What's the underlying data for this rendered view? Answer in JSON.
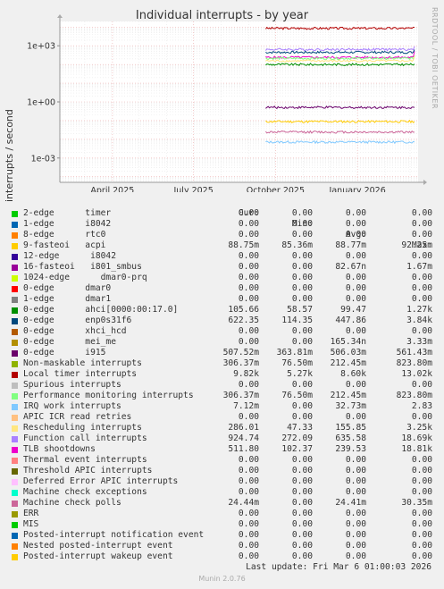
{
  "chart_data": {
    "type": "line",
    "title": "Individual interrupts - by year",
    "ylabel": "interrupts / second",
    "yscale": "log",
    "ylim": [
      5e-05,
      20000
    ],
    "ytick_labels": [
      "1e+03",
      "1e+00",
      "1e-03"
    ],
    "ytick_values": [
      1000,
      1,
      0.001
    ],
    "xlim": [
      "2025-02-01",
      "2026-03-10"
    ],
    "xtick_labels": [
      "April 2025",
      "July 2025",
      "October 2025",
      "January 2026"
    ],
    "xtick_dates": [
      "2025-04-01",
      "2025-07-01",
      "2025-10-01",
      "2026-01-01"
    ],
    "grid": true,
    "data_start": "2025-09-20",
    "series": [
      {
        "name": "Local timer interrupts",
        "values": [
          9820,
          8600,
          13020,
          5270
        ]
      },
      {
        "name": "Function call interrupts",
        "values": [
          924.74,
          635.58,
          18690,
          272.09
        ]
      },
      {
        "name": "TLB shootdowns",
        "values": [
          511.8,
          239.53,
          18810,
          102.37
        ]
      },
      {
        "name": "Performance monitoring interrupts",
        "values": [
          306.37,
          212.45,
          823.8,
          76.5
        ]
      },
      {
        "name": "enp0s31f6",
        "values": [
          622.35,
          447.86,
          3840,
          114.35
        ]
      },
      {
        "name": "Rescheduling interrupts",
        "values": [
          286.01,
          155.85,
          3250,
          47.33
        ]
      },
      {
        "name": "ahci[0000:00:17.0]",
        "values": [
          105.66,
          99.47,
          1270,
          58.57
        ]
      },
      {
        "name": "i915",
        "values": [
          0.50752,
          0.50603,
          0.56143,
          0.36381
        ]
      },
      {
        "name": "acpi",
        "values": [
          0.08875,
          0.08877,
          0.09225,
          0.08536
        ]
      },
      {
        "name": "Machine check polls",
        "values": [
          0.02444,
          0.02441,
          0.03035,
          0
        ]
      },
      {
        "name": "IRQ work interrupts",
        "values": [
          0.00712,
          0.0,
          2.83,
          0
        ]
      }
    ]
  },
  "legend": {
    "headers": {
      "cur": "Cur:",
      "min": "Min:",
      "avg": "Avg:",
      "max": "Max:"
    },
    "rows": [
      {
        "label": "2-edge      timer",
        "color": "#00cc00",
        "cur": "0.00",
        "min": "0.00",
        "avg": "0.00",
        "max": "0.00"
      },
      {
        "label": "1-edge      i8042",
        "color": "#0066b3",
        "cur": "0.00",
        "min": "0.00",
        "avg": "0.00",
        "max": "0.00"
      },
      {
        "label": "8-edge      rtc0",
        "color": "#ff8000",
        "cur": "0.00",
        "min": "0.00",
        "avg": "0.00",
        "max": "0.00"
      },
      {
        "label": "9-fasteoi   acpi",
        "color": "#ffcc00",
        "cur": "88.75m",
        "min": "85.36m",
        "avg": "88.77m",
        "max": "92.25m"
      },
      {
        "label": "12-edge      i8042",
        "color": "#330099",
        "cur": "0.00",
        "min": "0.00",
        "avg": "0.00",
        "max": "0.00"
      },
      {
        "label": "16-fasteoi   i801_smbus",
        "color": "#990099",
        "cur": "0.00",
        "min": "0.00",
        "avg": "82.67n",
        "max": "1.67m"
      },
      {
        "label": "1024-edge      dmar0-prq",
        "color": "#ccff00",
        "cur": "0.00",
        "min": "0.00",
        "avg": "0.00",
        "max": "0.00"
      },
      {
        "label": "0-edge      dmar0",
        "color": "#ff0000",
        "cur": "0.00",
        "min": "0.00",
        "avg": "0.00",
        "max": "0.00"
      },
      {
        "label": "1-edge      dmar1",
        "color": "#808080",
        "cur": "0.00",
        "min": "0.00",
        "avg": "0.00",
        "max": "0.00"
      },
      {
        "label": "0-edge      ahci[0000:00:17.0]",
        "color": "#008f00",
        "cur": "105.66",
        "min": "58.57",
        "avg": "99.47",
        "max": "1.27k"
      },
      {
        "label": "0-edge      enp0s31f6",
        "color": "#00487d",
        "cur": "622.35",
        "min": "114.35",
        "avg": "447.86",
        "max": "3.84k"
      },
      {
        "label": "0-edge      xhci_hcd",
        "color": "#b35a00",
        "cur": "0.00",
        "min": "0.00",
        "avg": "0.00",
        "max": "0.00"
      },
      {
        "label": "0-edge      mei_me",
        "color": "#b38f00",
        "cur": "0.00",
        "min": "0.00",
        "avg": "165.34n",
        "max": "3.33m"
      },
      {
        "label": "0-edge      i915",
        "color": "#6b006b",
        "cur": "507.52m",
        "min": "363.81m",
        "avg": "506.03m",
        "max": "561.43m"
      },
      {
        "label": "Non-maskable interrupts",
        "color": "#8fb300",
        "cur": "306.37m",
        "min": "76.50m",
        "avg": "212.45m",
        "max": "823.80m"
      },
      {
        "label": "Local timer interrupts",
        "color": "#b30000",
        "cur": "9.82k",
        "min": "5.27k",
        "avg": "8.60k",
        "max": "13.02k"
      },
      {
        "label": "Spurious interrupts",
        "color": "#bebebe",
        "cur": "0.00",
        "min": "0.00",
        "avg": "0.00",
        "max": "0.00"
      },
      {
        "label": "Performance monitoring interrupts",
        "color": "#80ff80",
        "cur": "306.37m",
        "min": "76.50m",
        "avg": "212.45m",
        "max": "823.80m"
      },
      {
        "label": "IRQ work interrupts",
        "color": "#80c9ff",
        "cur": "7.12m",
        "min": "0.00",
        "avg": "32.73m",
        "max": "2.83"
      },
      {
        "label": "APIC ICR read retries",
        "color": "#ffc080",
        "cur": "0.00",
        "min": "0.00",
        "avg": "0.00",
        "max": "0.00"
      },
      {
        "label": "Rescheduling interrupts",
        "color": "#ffe680",
        "cur": "286.01",
        "min": "47.33",
        "avg": "155.85",
        "max": "3.25k"
      },
      {
        "label": "Function call interrupts",
        "color": "#aa80ff",
        "cur": "924.74",
        "min": "272.09",
        "avg": "635.58",
        "max": "18.69k"
      },
      {
        "label": "TLB shootdowns",
        "color": "#ee00cc",
        "cur": "511.80",
        "min": "102.37",
        "avg": "239.53",
        "max": "18.81k"
      },
      {
        "label": "Thermal event interrupts",
        "color": "#ff8080",
        "cur": "0.00",
        "min": "0.00",
        "avg": "0.00",
        "max": "0.00"
      },
      {
        "label": "Threshold APIC interrupts",
        "color": "#666600",
        "cur": "0.00",
        "min": "0.00",
        "avg": "0.00",
        "max": "0.00"
      },
      {
        "label": "Deferred Error APIC interrupts",
        "color": "#ffbfff",
        "cur": "0.00",
        "min": "0.00",
        "avg": "0.00",
        "max": "0.00"
      },
      {
        "label": "Machine check exceptions",
        "color": "#00ffcc",
        "cur": "0.00",
        "min": "0.00",
        "avg": "0.00",
        "max": "0.00"
      },
      {
        "label": "Machine check polls",
        "color": "#cc6699",
        "cur": "24.44m",
        "min": "0.00",
        "avg": "24.41m",
        "max": "30.35m"
      },
      {
        "label": "ERR",
        "color": "#999900",
        "cur": "0.00",
        "min": "0.00",
        "avg": "0.00",
        "max": "0.00"
      },
      {
        "label": "MIS",
        "color": "#00cc00",
        "cur": "0.00",
        "min": "0.00",
        "avg": "0.00",
        "max": "0.00"
      },
      {
        "label": "Posted-interrupt notification event",
        "color": "#0066b3",
        "cur": "0.00",
        "min": "0.00",
        "avg": "0.00",
        "max": "0.00"
      },
      {
        "label": "Nested posted-interrupt event",
        "color": "#ff8000",
        "cur": "0.00",
        "min": "0.00",
        "avg": "0.00",
        "max": "0.00"
      },
      {
        "label": "Posted-interrupt wakeup event",
        "color": "#ffcc00",
        "cur": "0.00",
        "min": "0.00",
        "avg": "0.00",
        "max": "0.00"
      }
    ]
  },
  "side_credit": "RRDTOOL / TOBI OETIKER",
  "last_update": "Last update: Fri Mar  6 01:00:03 2026",
  "footer": "Munin 2.0.76"
}
